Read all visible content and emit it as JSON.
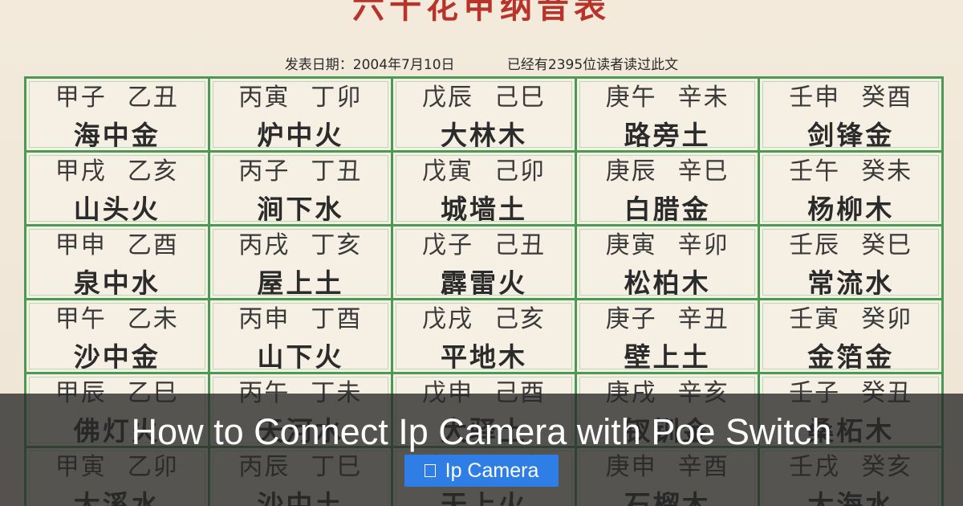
{
  "document": {
    "title": "六十花甲纳音表",
    "date_text": "发表日期：2004年7月10日",
    "views_text": "已经有2395位读者读过此文"
  },
  "table": {
    "rows": [
      [
        {
          "pair": [
            "甲子",
            "乙丑"
          ],
          "nayin": "海中金"
        },
        {
          "pair": [
            "丙寅",
            "丁卯"
          ],
          "nayin": "炉中火"
        },
        {
          "pair": [
            "戊辰",
            "己巳"
          ],
          "nayin": "大林木"
        },
        {
          "pair": [
            "庚午",
            "辛未"
          ],
          "nayin": "路旁土"
        },
        {
          "pair": [
            "壬申",
            "癸酉"
          ],
          "nayin": "剑锋金"
        }
      ],
      [
        {
          "pair": [
            "甲戌",
            "乙亥"
          ],
          "nayin": "山头火"
        },
        {
          "pair": [
            "丙子",
            "丁丑"
          ],
          "nayin": "涧下水"
        },
        {
          "pair": [
            "戊寅",
            "己卯"
          ],
          "nayin": "城墙土"
        },
        {
          "pair": [
            "庚辰",
            "辛巳"
          ],
          "nayin": "白腊金"
        },
        {
          "pair": [
            "壬午",
            "癸未"
          ],
          "nayin": "杨柳木"
        }
      ],
      [
        {
          "pair": [
            "甲申",
            "乙酉"
          ],
          "nayin": "泉中水"
        },
        {
          "pair": [
            "丙戌",
            "丁亥"
          ],
          "nayin": "屋上土"
        },
        {
          "pair": [
            "戊子",
            "己丑"
          ],
          "nayin": "霹雷火"
        },
        {
          "pair": [
            "庚寅",
            "辛卯"
          ],
          "nayin": "松柏木"
        },
        {
          "pair": [
            "壬辰",
            "癸巳"
          ],
          "nayin": "常流水"
        }
      ],
      [
        {
          "pair": [
            "甲午",
            "乙未"
          ],
          "nayin": "沙中金"
        },
        {
          "pair": [
            "丙申",
            "丁酉"
          ],
          "nayin": "山下火"
        },
        {
          "pair": [
            "戊戌",
            "己亥"
          ],
          "nayin": "平地木"
        },
        {
          "pair": [
            "庚子",
            "辛丑"
          ],
          "nayin": "壁上土"
        },
        {
          "pair": [
            "壬寅",
            "癸卯"
          ],
          "nayin": "金箔金"
        }
      ],
      [
        {
          "pair": [
            "甲辰",
            "乙巳"
          ],
          "nayin": "佛灯火"
        },
        {
          "pair": [
            "丙午",
            "丁未"
          ],
          "nayin": "天河水"
        },
        {
          "pair": [
            "戊申",
            "己酉"
          ],
          "nayin": "大驿土"
        },
        {
          "pair": [
            "庚戌",
            "辛亥"
          ],
          "nayin": "钗钏金"
        },
        {
          "pair": [
            "壬子",
            "癸丑"
          ],
          "nayin": "桑柘木"
        }
      ],
      [
        {
          "pair": [
            "甲寅",
            "乙卯"
          ],
          "nayin": "大溪水"
        },
        {
          "pair": [
            "丙辰",
            "丁巳"
          ],
          "nayin": "沙中土"
        },
        {
          "pair": [
            "戊午",
            "己未"
          ],
          "nayin": "天上火"
        },
        {
          "pair": [
            "庚申",
            "辛酉"
          ],
          "nayin": "石榴木"
        },
        {
          "pair": [
            "壬戌",
            "癸亥"
          ],
          "nayin": "大海水"
        }
      ]
    ]
  },
  "overlay": {
    "headline": "How to Connect Ip Camera with Poe Switch",
    "tag_label": "Ip Camera",
    "tag_icon": "folder-icon"
  },
  "colors": {
    "grid_border": "#4b9a54",
    "title_red": "#b8342a",
    "tag_blue": "#2f7ee6"
  }
}
